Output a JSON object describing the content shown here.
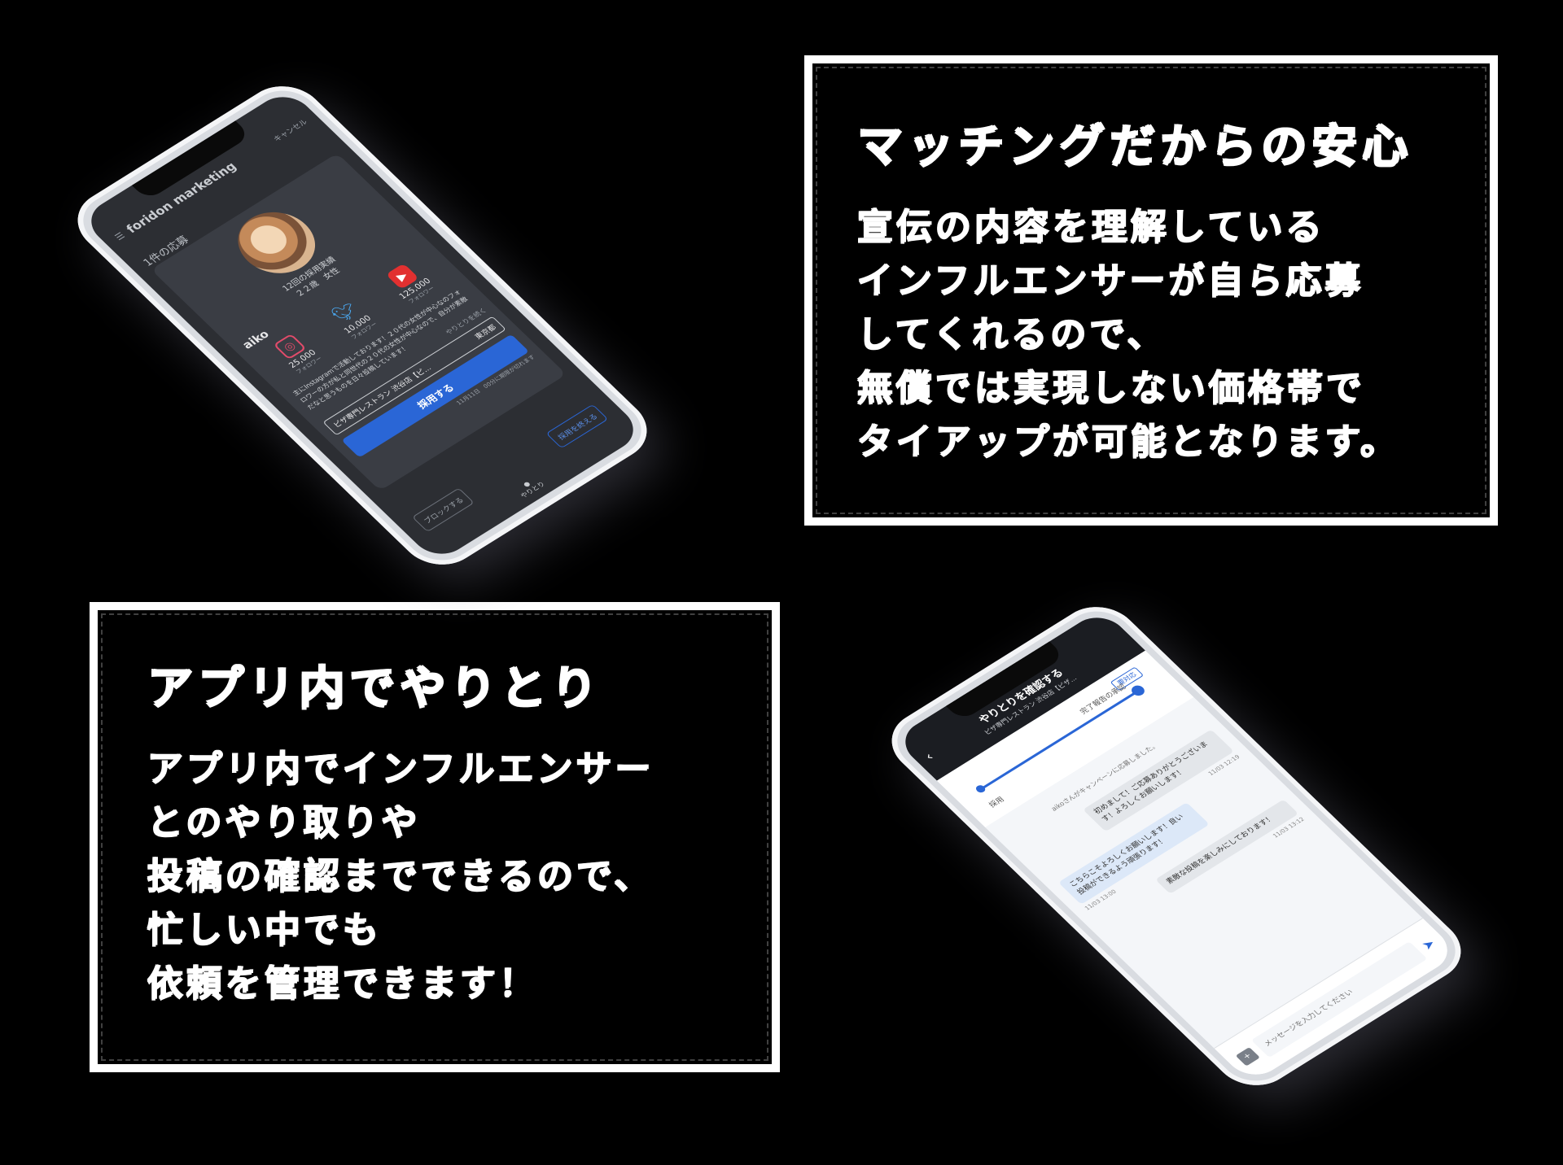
{
  "box_top": {
    "title": "マッチングだからの安心",
    "lines": [
      "宣伝の内容を理解している",
      "インフルエンサーが自ら応募",
      "してくれるので、",
      "無償では実現しない価格帯で",
      "タイアップが可能となります。"
    ]
  },
  "box_bottom": {
    "title": "アプリ内でやりとり",
    "lines": [
      "アプリ内でインフルエンサー",
      "とのやり取りや",
      "投稿の確認までできるので、",
      "忙しい中でも",
      "依頼を管理できます！"
    ]
  },
  "phone_a": {
    "logo": "foridon marketing",
    "header_link": "キャンセル",
    "count": "1件の応募",
    "profile": {
      "meta1": "12回の採用実績",
      "meta2": "２２歳　女性",
      "name": "aiko"
    },
    "sns": [
      {
        "icon": "instagram-icon",
        "count": "25,000",
        "label": "フォロワー"
      },
      {
        "icon": "twitter-icon",
        "count": "10,000",
        "label": "フォロワー"
      },
      {
        "icon": "youtube-icon",
        "count": "125,000",
        "label": "フォロワー"
      }
    ],
    "description": "主にInstagramで活動しております！２０代の女性が中心なのフォロワーの方が私と同世代の２０代の女性が中心なので、自分が素敵だなと思うものを日々投稿しています！",
    "more_link": "やりとりを続く",
    "campaign": {
      "name": "ピザ専門レストラン 渋谷店【ピ…",
      "place": "東京都"
    },
    "hire_button": "採用する",
    "hire_note": "11月11日　00分に期限が切れます",
    "end_button": "採用を終える",
    "block_button": "ブロックする",
    "bottom_label": "やりとり"
  },
  "phone_b": {
    "title": "やりとりを確認する",
    "subtitle": "ピザ専門レストラン 渋谷店【ピザ…",
    "stage_left": "採用",
    "stage_right": "完了報告の承認",
    "badge": "要対応",
    "system_message": "aikoさんがキャンペーンに応募しました。",
    "messages": [
      {
        "side": "in",
        "text": "初めまして！ご応募ありがとうございます！よろしくお願いします！",
        "time": "11/03 12:19"
      },
      {
        "side": "out",
        "text": "こちらこそよろしくお願いします！良い投稿ができるよう頑張ります！",
        "time": "11/03 13:00"
      },
      {
        "side": "in",
        "text": "素敵な投稿を楽しみにしております！",
        "time": "11/03 13:12"
      }
    ],
    "input_placeholder": "メッセージを入力してください"
  },
  "colors": {
    "accent": "#2a66d6",
    "dark_screen": "#2c2e33"
  }
}
